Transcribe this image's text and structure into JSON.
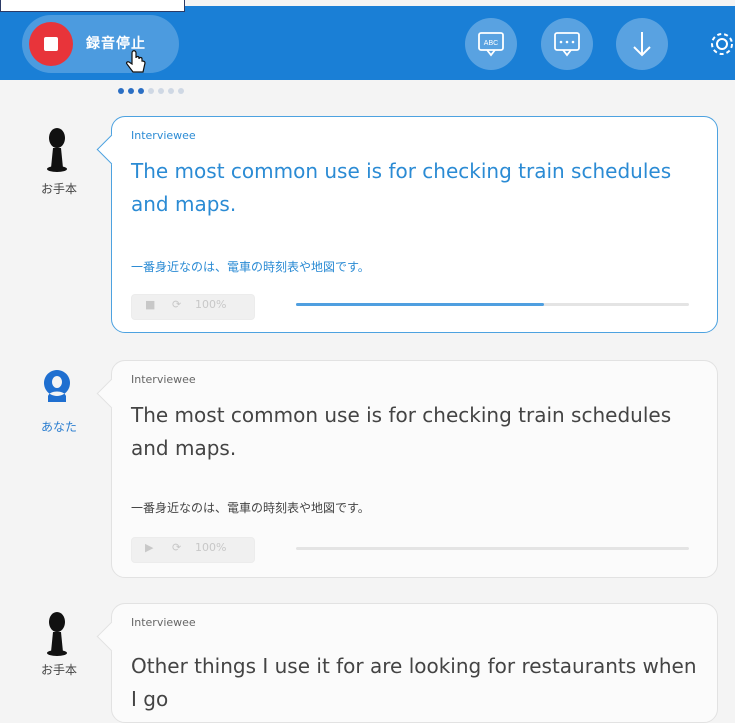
{
  "toolbar": {
    "record_stop_label": "録音停止",
    "colors": {
      "bar": "#1a7fd6",
      "record": "#e8343a"
    },
    "buttons": [
      {
        "icon": "abc-bubble-icon",
        "label": "ABC"
      },
      {
        "icon": "chat-bubble-icon"
      },
      {
        "icon": "download-arrow-icon"
      },
      {
        "icon": "gear-icon"
      }
    ]
  },
  "pager": {
    "total": 7,
    "active": [
      0,
      1,
      2
    ]
  },
  "messages": [
    {
      "avatar_label": "お手本",
      "avatar_icon": "person-silhouette-icon",
      "speaker": "Interviewee",
      "english": "The most common use is for checking train schedules and maps.",
      "japanese": "一番身近なのは、電車の時刻表や地図です。",
      "controls": {
        "play": "■",
        "replay": "⟳",
        "speed": "100%"
      },
      "progress": 0.63,
      "active": true
    },
    {
      "avatar_label": "あなた",
      "avatar_icon": "user-avatar-icon",
      "speaker": "Interviewee",
      "english": "The most common use is for checking train schedules and maps.",
      "japanese": "一番身近なのは、電車の時刻表や地図です。",
      "controls": {
        "play": "▶",
        "replay": "⟳",
        "speed": "100%"
      },
      "progress": 0,
      "active": false
    },
    {
      "avatar_label": "お手本",
      "avatar_icon": "person-silhouette-icon",
      "speaker": "Interviewee",
      "english": "Other things I use it for are looking for restaurants when I go",
      "active": false
    }
  ]
}
